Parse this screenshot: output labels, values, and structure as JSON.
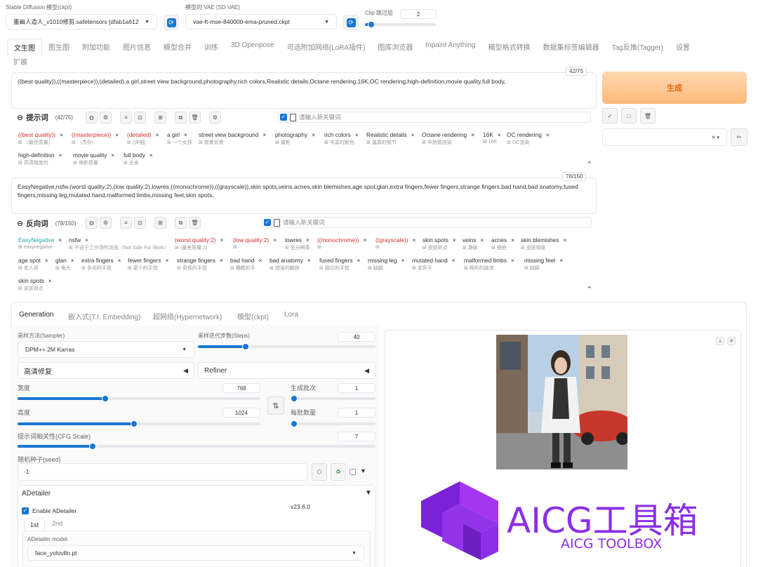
{
  "header": {
    "model_label": "Stable Diffusion 模型(ckpt)",
    "model_value": "墨幽人造人_v1010修剪.safetensors [dfab1a612",
    "vae_label": "模型的 VAE (SD VAE)",
    "vae_value": "vae-ft-mse-840000-ema-pruned.ckpt",
    "clip_label": "Clip 跳过层",
    "clip_value": "2",
    "clip_fraction": 0.09
  },
  "tabs": [
    "文生图",
    "图生图",
    "附加功能",
    "图片信息",
    "模型合并",
    "训练",
    "3D Openpose",
    "可选附加网络(LoRA插件)",
    "图库浏览器",
    "Inpaint Anything",
    "模型格式转换",
    "数据集标签编辑器",
    "Tag反推(Tagger)",
    "设置"
  ],
  "tab_extra": "扩展",
  "prompt": {
    "text": "((best quality)),((masterpiece)),(detailed),a girl,street view background,photography,rich colors,Realistic details,Octane rendering,16K,OC rendering,high-definition,movie quality,full body,",
    "count": "42/75",
    "title": "提示词",
    "title_count": "(42/75)",
    "keyword_placeholder": "请输入新关键词",
    "tokens": [
      {
        "t": "((best quality))",
        "tr": "（最佳质量）",
        "c": "red"
      },
      {
        "t": "((masterpiece))",
        "tr": "（杰作）",
        "c": "red"
      },
      {
        "t": "(detailed)",
        "tr": "(详细)",
        "c": "red"
      },
      {
        "t": "a girl",
        "tr": "一个女孩",
        "c": ""
      },
      {
        "t": "street view background",
        "tr": "街景背景",
        "c": ""
      },
      {
        "t": "photography",
        "tr": "摄影",
        "c": ""
      },
      {
        "t": "rich colors",
        "tr": "丰富的颜色",
        "c": ""
      },
      {
        "t": "Realistic details",
        "tr": "逼真的细节",
        "c": ""
      },
      {
        "t": "Octane rendering",
        "tr": "辛烷值渲染",
        "c": ""
      },
      {
        "t": "16K",
        "tr": "16K",
        "c": ""
      },
      {
        "t": "OC rendering",
        "tr": "OC渲染",
        "c": ""
      },
      {
        "t": "high-definition",
        "tr": "高清晰度的",
        "c": ""
      },
      {
        "t": "movie quality",
        "tr": "电影质量",
        "c": ""
      },
      {
        "t": "full body",
        "tr": "全身",
        "c": ""
      }
    ]
  },
  "negative": {
    "text": "EasyNegative,nsfw,(worst quality:2),(low quality:2),lowres,((monochrome)),((grayscale)),skin spots,veins,acnes,skin blemishes,age spot,glan,extra fingers,fewer fingers,strange fingers,bad hand,bad anatomy,fused fingers,missing leg,mutated hand,malformed limbs,missing feet,skin spots,",
    "count": "78/150",
    "title": "反向词",
    "title_count": "(78/150)",
    "keyword_placeholder": "请输入新关键词",
    "tokens": [
      {
        "t": "EasyNegative",
        "tr": "easynegative",
        "c": "teal"
      },
      {
        "t": "nsfw",
        "tr": "不适于工作场所浏览（Not Safe For Work）",
        "c": ""
      },
      {
        "t": "(worst quality:2)",
        "tr": "(最差质量:2)",
        "c": "red"
      },
      {
        "t": "(low quality:2)",
        "tr": "",
        "c": "red"
      },
      {
        "t": "lowres",
        "tr": "低分辨率",
        "c": ""
      },
      {
        "t": "((monochrome))",
        "tr": "",
        "c": "red"
      },
      {
        "t": "((grayscale))",
        "tr": "",
        "c": "red"
      },
      {
        "t": "skin spots",
        "tr": "皮肤斑点",
        "c": ""
      },
      {
        "t": "veins",
        "tr": "静脉",
        "c": ""
      },
      {
        "t": "acnes",
        "tr": "痤疮",
        "c": ""
      },
      {
        "t": "skin blemishes",
        "tr": "皮肤瑕疵",
        "c": ""
      },
      {
        "t": "age spot",
        "tr": "老人斑",
        "c": ""
      },
      {
        "t": "glan",
        "tr": "龟头",
        "c": ""
      },
      {
        "t": "extra fingers",
        "tr": "多余的手指",
        "c": ""
      },
      {
        "t": "fewer fingers",
        "tr": "更少的手指",
        "c": ""
      },
      {
        "t": "strange fingers",
        "tr": "奇怪的手指",
        "c": ""
      },
      {
        "t": "bad hand",
        "tr": "糟糕的手",
        "c": ""
      },
      {
        "t": "bad anatomy",
        "tr": "错误的解剖",
        "c": ""
      },
      {
        "t": "fused fingers",
        "tr": "融合的手指",
        "c": ""
      },
      {
        "t": "missing leg",
        "tr": "缺腿",
        "c": ""
      },
      {
        "t": "mutated hand",
        "tr": "变异手",
        "c": ""
      },
      {
        "t": "malformed limbs",
        "tr": "畸形的肢体",
        "c": ""
      },
      {
        "t": "missing feet",
        "tr": "缺脚",
        "c": ""
      },
      {
        "t": "skin spots",
        "tr": "皮肤斑点",
        "c": ""
      }
    ]
  },
  "generate_label": "生成",
  "gen_tabs": [
    "Generation",
    "嵌入式(T.I. Embedding)",
    "超网络(Hypernetwork)",
    "模型(ckpt)",
    "Lora"
  ],
  "params": {
    "sampler_label": "采样方法(Sampler)",
    "sampler_value": "DPM++ 2M Karras",
    "steps_label": "采样迭代步数(Steps)",
    "steps_value": "40",
    "steps_fraction": 0.27,
    "hires_label": "高清修复",
    "refiner_label": "Refiner",
    "width_label": "宽度",
    "width_value": "768",
    "width_fraction": 0.36,
    "height_label": "高度",
    "height_value": "1024",
    "height_fraction": 0.48,
    "batch_count_label": "生成批次",
    "batch_count_value": "1",
    "batch_size_label": "每批数量",
    "batch_size_value": "1",
    "cfg_label": "提示词相关性(CFG Scale)",
    "cfg_value": "7",
    "cfg_fraction": 0.21,
    "seed_label": "随机种子(seed)",
    "seed_value": "-1"
  },
  "adetailer": {
    "title": "ADetailer",
    "enable_label": "Enable ADetailer",
    "version": "v23.6.0",
    "tab1": "1st",
    "tab2": "2nd",
    "model_label": "ADetailer model",
    "model_value": "face_yolov8n.pt"
  },
  "watermark": {
    "title": "AICG工具箱",
    "subtitle": "AICG TOOLBOX",
    "color": "#8b2fe8"
  }
}
